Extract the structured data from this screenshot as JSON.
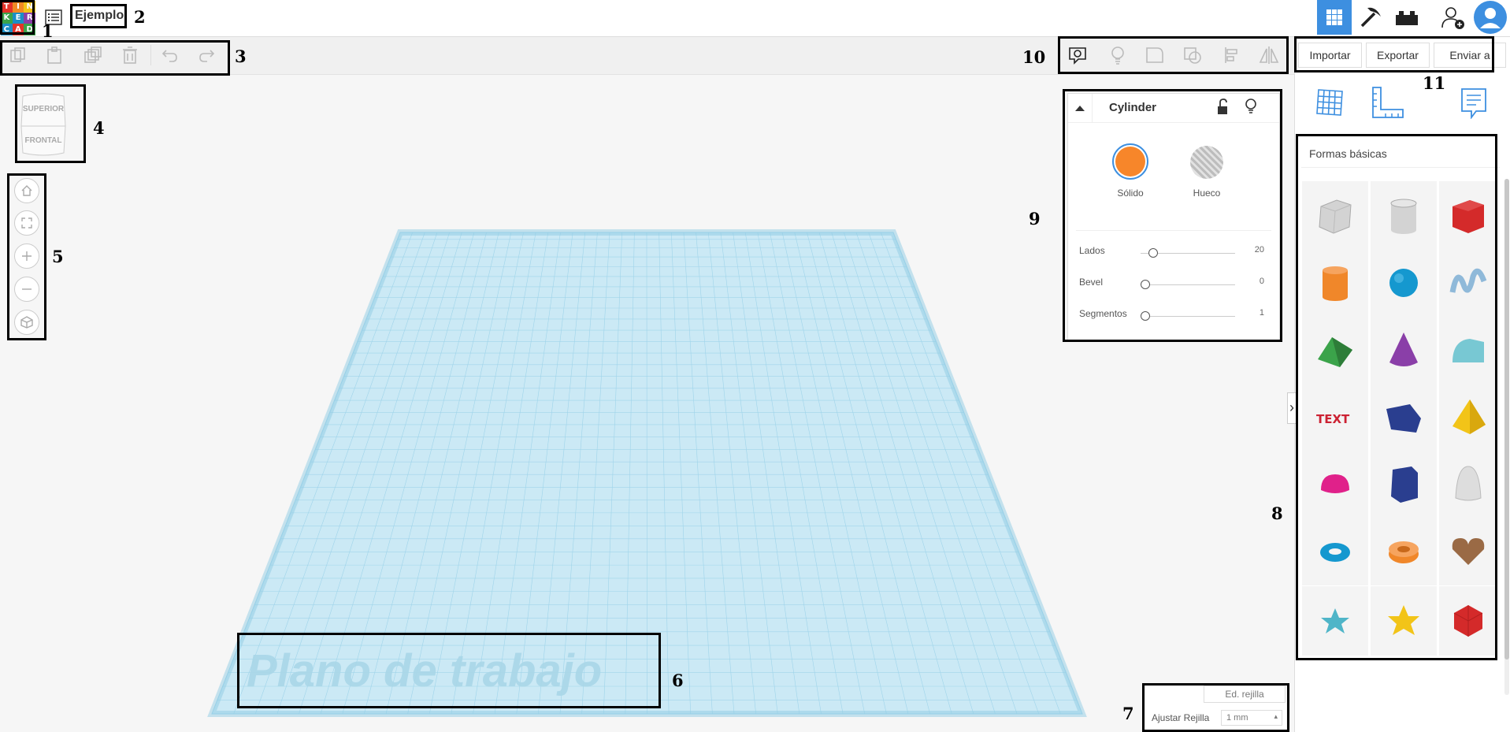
{
  "app": {
    "project_name": "Ejemplo",
    "logo_letters": [
      "T",
      "I",
      "N",
      "K",
      "E",
      "R",
      "C",
      "A",
      "D"
    ]
  },
  "colors": {
    "accent": "#3d8fe0",
    "orange": "#f7862a",
    "grid_line": "#9fd4ea",
    "grid_fill": "#cbe9f5"
  },
  "header": {
    "buttons": [
      {
        "name": "3d-design-view-icon",
        "active": true
      },
      {
        "name": "pickaxe-icon",
        "active": false
      },
      {
        "name": "bricks-icon",
        "active": false
      },
      {
        "name": "add-user-icon",
        "active": false
      },
      {
        "name": "user-avatar-icon",
        "active": false
      }
    ],
    "import_label": "Importar",
    "export_label": "Exportar",
    "send_label": "Enviar a"
  },
  "toolbar": {
    "edit_tools": [
      "copy-icon",
      "paste-icon",
      "duplicate-icon",
      "delete-icon",
      "undo-icon",
      "redo-icon"
    ],
    "shape_tools": [
      "note-icon",
      "light-bulb-icon",
      "group-icon",
      "ungroup-icon",
      "align-icon",
      "mirror-icon"
    ]
  },
  "viewcube": {
    "top": "SUPERIOR",
    "front": "FRONTAL"
  },
  "nav_buttons": [
    "home-view-icon",
    "fit-view-icon",
    "zoom-in-icon",
    "zoom-out-icon",
    "ortho-view-icon"
  ],
  "workplane": {
    "label": "Plano de trabajo"
  },
  "grid_settings": {
    "edit_label": "Ed. rejilla",
    "snap_label": "Ajustar Rejilla",
    "snap_value": "1 mm"
  },
  "inspector": {
    "title": "Cylinder",
    "solid_label": "Sólido",
    "hole_label": "Hueco",
    "params": [
      {
        "label": "Lados",
        "value": "20",
        "position": 0.05
      },
      {
        "label": "Bevel",
        "value": "0",
        "position": 0
      },
      {
        "label": "Segmentos",
        "value": "1",
        "position": 0
      }
    ]
  },
  "library": {
    "category": "Formas básicas",
    "shapes": [
      {
        "name": "box-hole",
        "color": "#c7c7c7"
      },
      {
        "name": "cylinder-hole",
        "color": "#c7c7c7"
      },
      {
        "name": "box",
        "color": "#d42a2a"
      },
      {
        "name": "cylinder",
        "color": "#f0872a"
      },
      {
        "name": "sphere",
        "color": "#1598cf"
      },
      {
        "name": "scribble",
        "color": "#8fb9d9"
      },
      {
        "name": "roof",
        "color": "#3ba34a"
      },
      {
        "name": "cone",
        "color": "#8a3fa8"
      },
      {
        "name": "round-roof",
        "color": "#78c8d3"
      },
      {
        "name": "text",
        "color": "#cc2233"
      },
      {
        "name": "wedge",
        "color": "#2a3e8f"
      },
      {
        "name": "pyramid",
        "color": "#f2c418"
      },
      {
        "name": "half-sphere",
        "color": "#e0218a"
      },
      {
        "name": "polygon",
        "color": "#2a3e8f"
      },
      {
        "name": "paraboloid",
        "color": "#dddddd"
      },
      {
        "name": "torus",
        "color": "#1598cf"
      },
      {
        "name": "tube",
        "color": "#f0872a"
      },
      {
        "name": "heart",
        "color": "#9a6a45"
      },
      {
        "name": "star",
        "color": "#4fb5c8"
      },
      {
        "name": "star-yellow",
        "color": "#f2c418"
      },
      {
        "name": "icosahedron",
        "color": "#d42a2a"
      }
    ]
  },
  "annotations": [
    "1",
    "2",
    "3",
    "4",
    "5",
    "6",
    "7",
    "8",
    "9",
    "10",
    "11"
  ]
}
